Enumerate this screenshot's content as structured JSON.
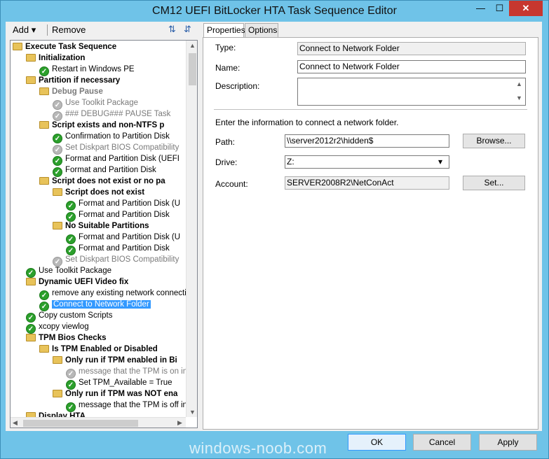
{
  "window": {
    "title": "CM12 UEFI BitLocker HTA Task Sequence Editor",
    "min_glyph": "—",
    "max_glyph": "☐",
    "close_glyph": "✕"
  },
  "toolbar": {
    "add_label": "Add ▾",
    "remove_label": "Remove"
  },
  "tree": {
    "items": [
      {
        "label": "Execute Task Sequence",
        "icon": "folder",
        "bold": true
      },
      {
        "label": "Initialization",
        "icon": "folder",
        "bold": true
      },
      {
        "label": "Restart in Windows PE",
        "icon": "check"
      },
      {
        "label": "Partition if necessary",
        "icon": "folder",
        "bold": true
      },
      {
        "label": "Debug Pause",
        "icon": "folder",
        "bold": true,
        "disabled": true
      },
      {
        "label": "Use Toolkit Package",
        "icon": "check",
        "disabled": true
      },
      {
        "label": "### DEBUG### PAUSE Task",
        "icon": "check",
        "disabled": true
      },
      {
        "label": "Script exists and non-NTFS p",
        "icon": "folder",
        "bold": true
      },
      {
        "label": "Confirmation to Partition Disk",
        "icon": "check"
      },
      {
        "label": "Set Diskpart BIOS Compatibility",
        "icon": "check",
        "disabled": true
      },
      {
        "label": "Format and Partition Disk (UEFI",
        "icon": "check"
      },
      {
        "label": "Format and Partition Disk",
        "icon": "check"
      },
      {
        "label": "Script does not exist or no pa",
        "icon": "folder",
        "bold": true
      },
      {
        "label": "Script does not exist",
        "icon": "folder",
        "bold": true
      },
      {
        "label": "Format and Partition Disk (U",
        "icon": "check"
      },
      {
        "label": "Format and Partition Disk",
        "icon": "check"
      },
      {
        "label": "No Suitable Partitions",
        "icon": "folder",
        "bold": true
      },
      {
        "label": "Format and Partition Disk (U",
        "icon": "check"
      },
      {
        "label": "Format and Partition Disk",
        "icon": "check"
      },
      {
        "label": "Set Diskpart BIOS Compatibility",
        "icon": "check",
        "disabled": true
      },
      {
        "label": "Use Toolkit Package",
        "icon": "check"
      },
      {
        "label": "Dynamic UEFI Video fix",
        "icon": "folder",
        "bold": true
      },
      {
        "label": "remove any existing network connection",
        "icon": "check"
      },
      {
        "label": "Connect to Network Folder",
        "icon": "check",
        "selected": true
      },
      {
        "label": "Copy custom Scripts",
        "icon": "check"
      },
      {
        "label": "xcopy viewlog",
        "icon": "check"
      },
      {
        "label": "TPM Bios Checks",
        "icon": "folder",
        "bold": true
      },
      {
        "label": "Is TPM Enabled or Disabled",
        "icon": "folder",
        "bold": true
      },
      {
        "label": "Only run if TPM enabled in Bi",
        "icon": "folder",
        "bold": true
      },
      {
        "label": "message that the TPM is on in t",
        "icon": "check",
        "disabled": true
      },
      {
        "label": "Set TPM_Available = True",
        "icon": "check"
      },
      {
        "label": "Only run if TPM was NOT ena",
        "icon": "folder",
        "bold": true
      },
      {
        "label": "message that the TPM is off in t",
        "icon": "check"
      },
      {
        "label": "Display HTA",
        "icon": "folder",
        "bold": true
      }
    ]
  },
  "tabs": [
    {
      "label": "Properties",
      "active": true
    },
    {
      "label": "Options",
      "active": false
    }
  ],
  "properties": {
    "type_label": "Type:",
    "type_value": "Connect to Network Folder",
    "name_label": "Name:",
    "name_value": "Connect to Network Folder",
    "description_label": "Description:",
    "description_value": "",
    "info_text": "Enter the information to connect a network folder.",
    "path_label": "Path:",
    "path_value": "\\\\server2012r2\\hidden$",
    "browse_label": "Browse...",
    "drive_label": "Drive:",
    "drive_value": "Z:",
    "account_label": "Account:",
    "account_value": "SERVER2008R2\\NetConAct",
    "set_label": "Set..."
  },
  "footer": {
    "ok_label": "OK",
    "cancel_label": "Cancel",
    "apply_label": "Apply"
  },
  "watermark": "windows-noob.com"
}
